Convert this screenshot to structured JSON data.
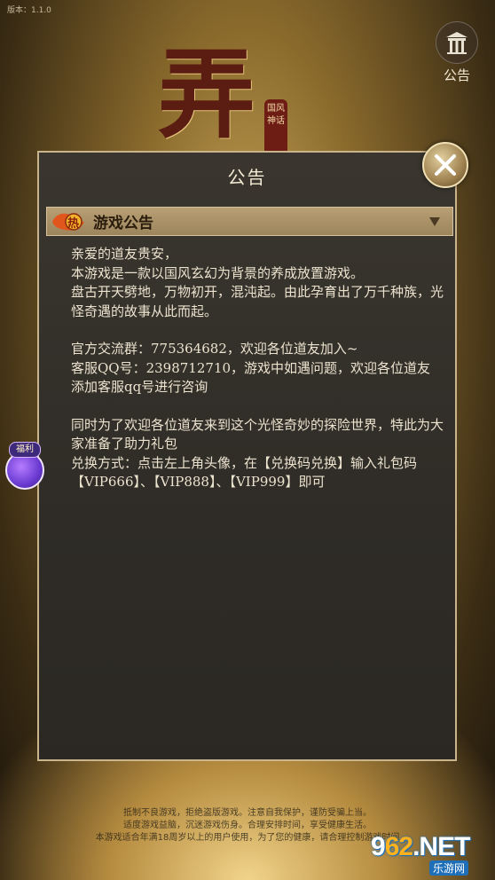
{
  "version_text": "版本：1.1.0",
  "logo": {
    "main_char": "弄",
    "seal_text": "国风神话"
  },
  "top_right": {
    "announce_label": "公告",
    "icon": "notice-board-icon"
  },
  "modal": {
    "title": "公告",
    "close_icon": "close-icon",
    "section": {
      "badge": "热",
      "label": "游戏公告",
      "chevron": "chevron-down-icon"
    },
    "lines": [
      "亲爱的道友贵安，",
      "本游戏是一款以国风玄幻为背景的养成放置游戏。",
      "盘古开天劈地，万物初开，混沌起。由此孕育出了万千种族，光怪奇遇的故事从此而起。",
      "",
      "官方交流群：775364682，欢迎各位道友加入~",
      "客服QQ号：2398712710，游戏中如遇问题，欢迎各位道友添加客服qq号进行咨询",
      "",
      "同时为了欢迎各位道友来到这个光怪奇妙的探险世界，特此为大家准备了助力礼包",
      "兑换方式：点击左上角头像，在【兑换码兑换】输入礼包码【VIP666】、【VIP888】、【VIP999】即可"
    ]
  },
  "welfare": {
    "label": "福利"
  },
  "footer": [
    "抵制不良游戏，拒绝盗版游戏。注意自我保护，谨防受骗上当。",
    "适度游戏益脑，沉迷游戏伤身。合理安排时间，享受健康生活。",
    "本游戏适合年满18周岁以上的用户使用，为了您的健康，请合理控制游戏时间"
  ],
  "watermark": {
    "main_a": "9",
    "main_b": "62",
    "main_c": ".NET",
    "sub": "乐游网"
  },
  "colors": {
    "frame": "#c9b48c",
    "panel": "#2f2c27",
    "header": "#a8906a",
    "text": "#ece3cf"
  }
}
